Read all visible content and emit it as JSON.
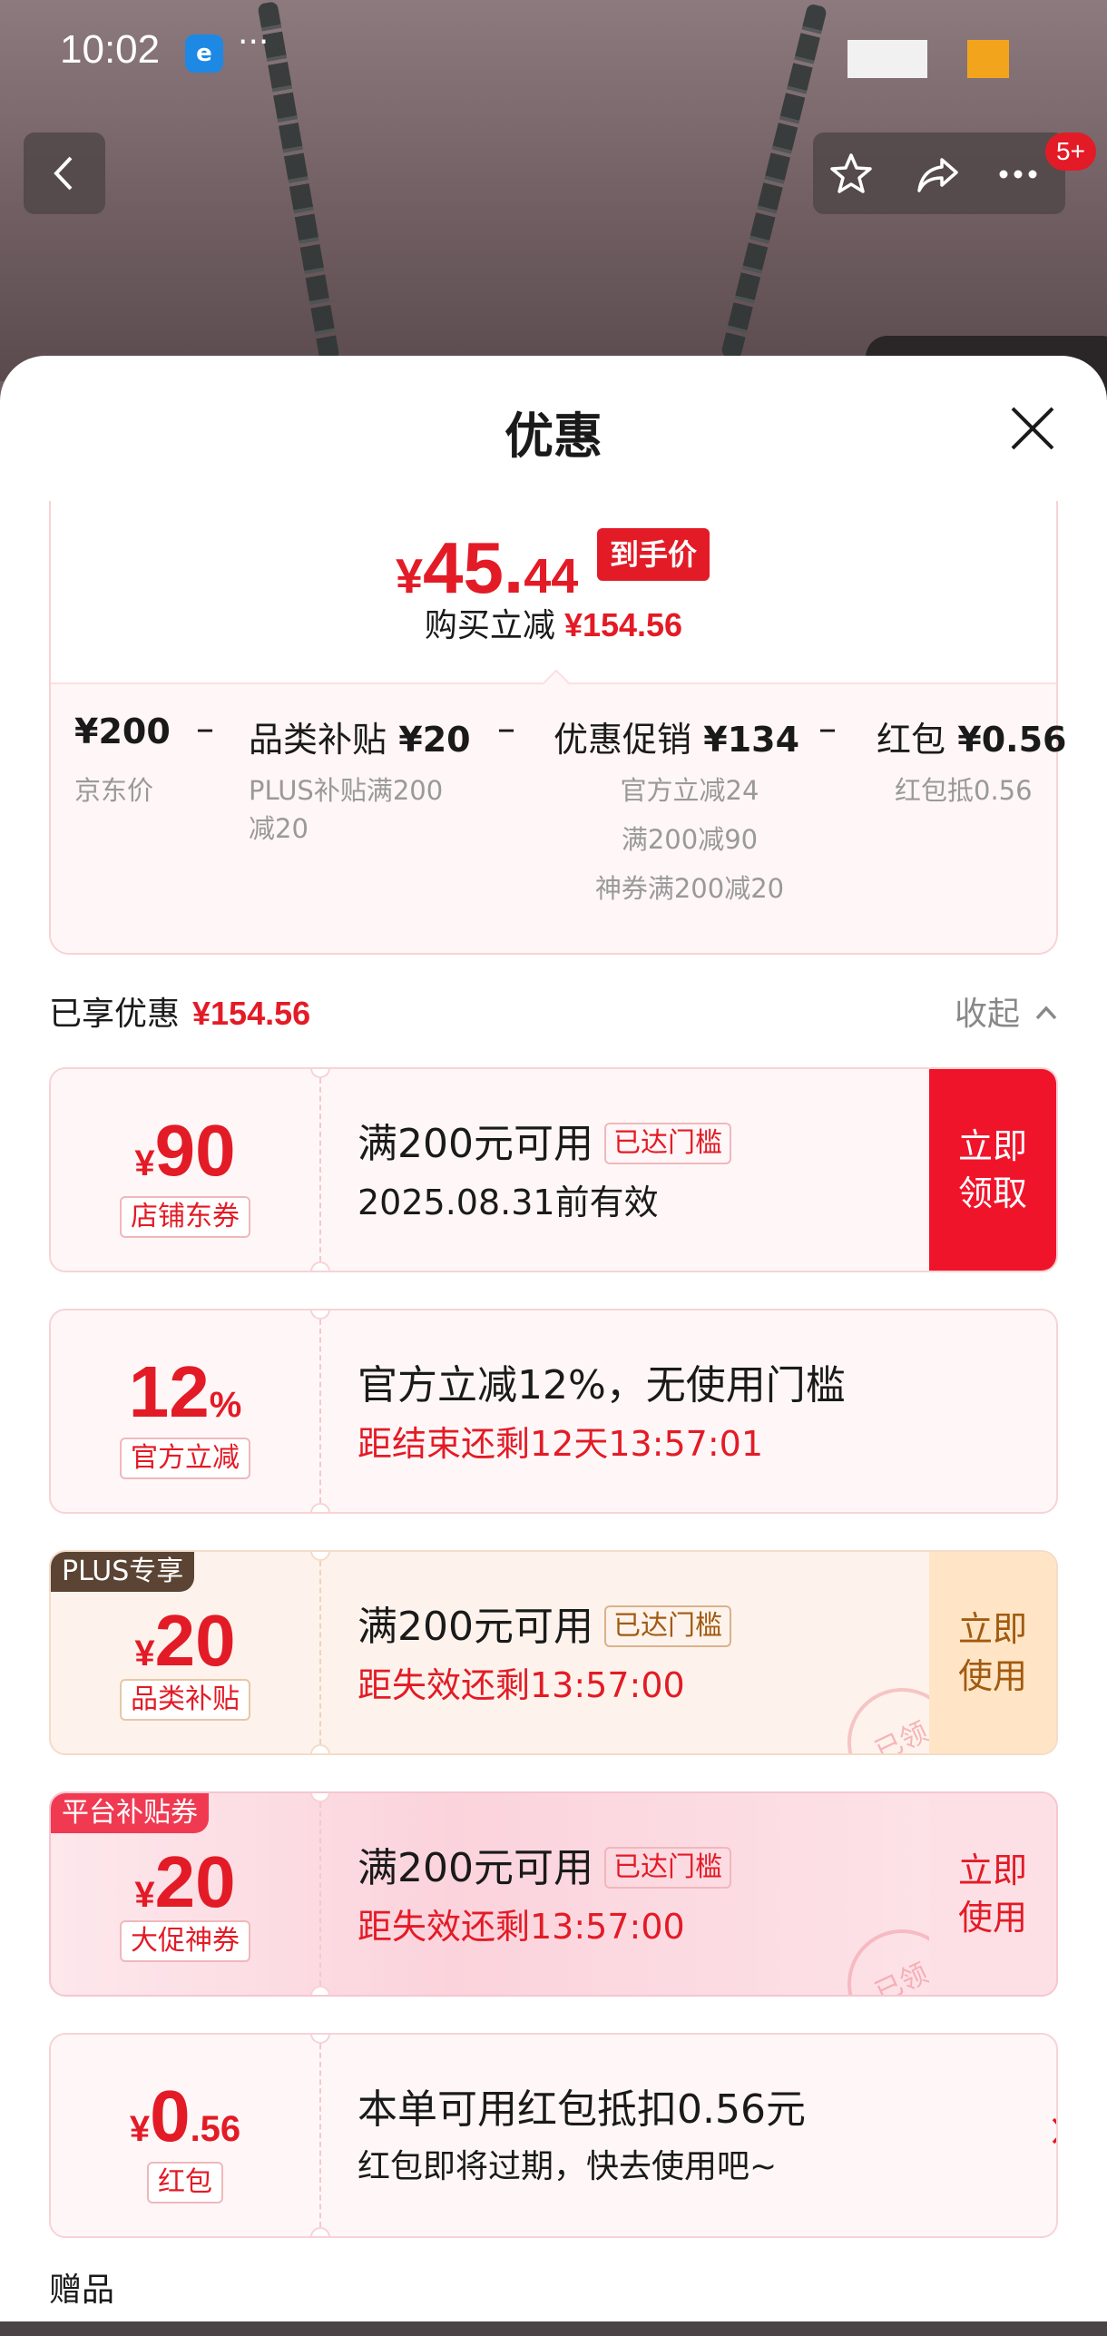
{
  "status_bar": {
    "time": "10:02",
    "app_icon": "app-icon",
    "more": "···"
  },
  "nav": {
    "back_icon": "chevron-left-icon",
    "star_icon": "star-icon",
    "share_icon": "share-icon",
    "more_icon": "more-icon",
    "badge": "5+"
  },
  "sheet": {
    "title": "优惠",
    "summary": {
      "price_currency": "¥",
      "price_int": "45.",
      "price_dec": "44",
      "to_hand_label": "到手价",
      "buy_reduce_label": "购买立减",
      "buy_reduce_amount": "¥154.56",
      "calc": [
        {
          "label": "",
          "value": "¥200",
          "sub": [
            "京东价"
          ]
        },
        {
          "label": "品类补贴",
          "value": "¥20",
          "sub": [
            "PLUS补贴满200",
            "减20"
          ]
        },
        {
          "label": "优惠促销",
          "value": "¥134",
          "sub": [
            "官方立减24",
            "满200减90",
            "神券满200减20"
          ]
        },
        {
          "label": "红包",
          "value": "¥0.56",
          "sub": [
            "红包抵0.56"
          ]
        }
      ],
      "operator": "–"
    },
    "enjoyed_label": "已享优惠",
    "enjoyed_amount": "¥154.56",
    "collapse_label": "收起",
    "coupons": [
      {
        "currency": "¥",
        "amount": "90",
        "tag": "店铺东券",
        "title": "满200元可用",
        "pill": "已达门槛",
        "sub": "2025.08.31前有效",
        "action": "立即领取"
      },
      {
        "amount": "12",
        "unit": "%",
        "tag": "官方立减",
        "title": "官方立减12%，无使用门槛",
        "sub": "距结束还剩12天13:57:01"
      },
      {
        "corner": "PLUS专享",
        "currency": "¥",
        "amount": "20",
        "tag": "品类补贴",
        "title": "满200元可用",
        "pill": "已达门槛",
        "sub": "距失效还剩13:57:00",
        "action": "立即使用",
        "stamp": "已领"
      },
      {
        "corner": "平台补贴券",
        "currency": "¥",
        "amount": "20",
        "tag": "大促神券",
        "title": "满200元可用",
        "pill": "已达门槛",
        "sub": "距失效还剩13:57:00",
        "action": "立即使用",
        "stamp": "已领"
      },
      {
        "currency": "¥",
        "amount": "0",
        "decimal": ".56",
        "tag": "红包",
        "title": "本单可用红包抵扣0.56元",
        "sub": "红包即将过期，快去使用吧~"
      }
    ],
    "gifts_label": "赠品"
  },
  "colors": {
    "accent_red": "#e31b26",
    "plus_gold": "#a25a10",
    "plus_corner": "#5b4433",
    "platform_corner": "#f03a52"
  }
}
